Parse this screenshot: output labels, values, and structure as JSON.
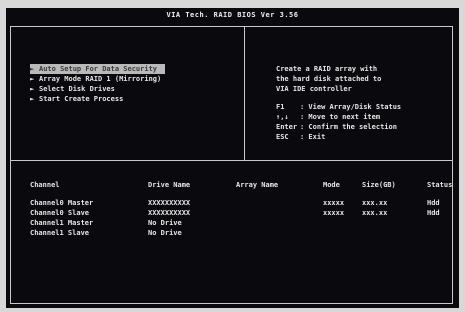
{
  "window": {
    "title": "VIA Tech. RAID BIOS Ver 3.56"
  },
  "menu": {
    "items": [
      {
        "bullet": "►",
        "label": "Auto Setup For Data Security"
      },
      {
        "bullet": "►",
        "label": "Array Mode RAID 1 (Mirroring)"
      },
      {
        "bullet": "►",
        "label": "Select Disk Drives"
      },
      {
        "bullet": "►",
        "label": "Start Create Process"
      }
    ],
    "selected_index": 0
  },
  "help": {
    "description": [
      "Create a RAID array with",
      "the hard disk attached to",
      "VIA IDE controller"
    ],
    "keys": [
      {
        "key": "F1",
        "desc": ": View Array/Disk Status"
      },
      {
        "key": "↑,↓",
        "desc": ": Move to next item"
      },
      {
        "key": "Enter",
        "desc": ": Confirm the selection"
      },
      {
        "key": "ESC",
        "desc": ": Exit"
      }
    ]
  },
  "table": {
    "headers": {
      "channel": "Channel",
      "drive": "Drive Name",
      "array": "Array Name",
      "mode": "Mode",
      "size": "Size(GB)",
      "status": "Status"
    },
    "rows": [
      {
        "channel": "Channel0 Master",
        "drive": "XXXXXXXXXX",
        "array": "",
        "mode": "xxxxx",
        "size": "xxx.xx",
        "status": "Hdd"
      },
      {
        "channel": "Channel0 Slave",
        "drive": "XXXXXXXXXX",
        "array": "",
        "mode": "xxxxx",
        "size": "xxx.xx",
        "status": "Hdd"
      },
      {
        "channel": "Channel1 Master",
        "drive": "No Drive",
        "array": "",
        "mode": "",
        "size": "",
        "status": ""
      },
      {
        "channel": "Channel1 Slave",
        "drive": "No Drive",
        "array": "",
        "mode": "",
        "size": "",
        "status": ""
      }
    ]
  },
  "colors": {
    "background": "#0a0a0e",
    "text": "#e6e6e6",
    "border": "#c8c8c8",
    "selected_bg": "#b9b9b9"
  }
}
